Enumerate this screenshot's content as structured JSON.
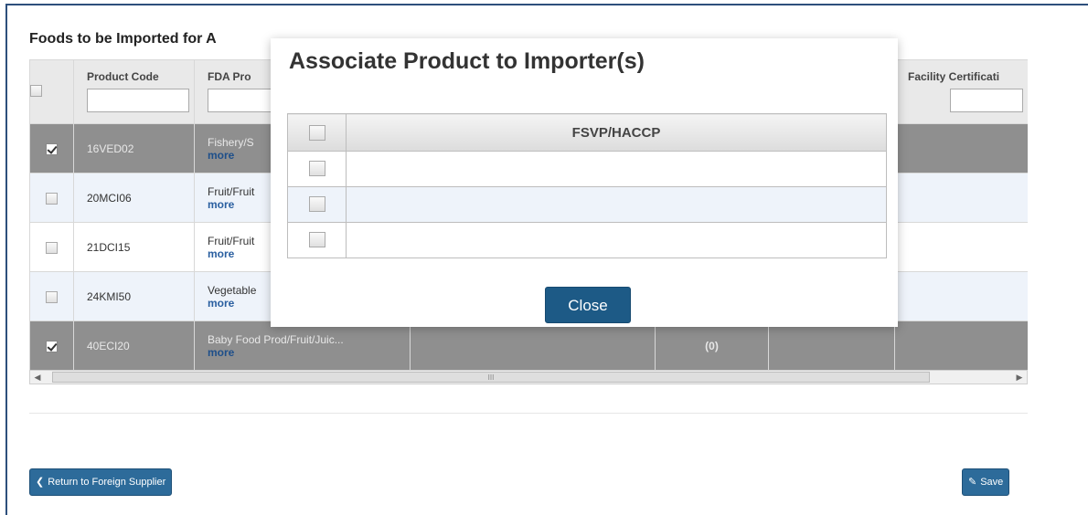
{
  "section": {
    "title": "Foods to be Imported for A"
  },
  "grid": {
    "columns": [
      {
        "label": "Product Code"
      },
      {
        "label": "FDA Pro"
      },
      {
        "label": ""
      },
      {
        "label": ""
      },
      {
        "label": ""
      },
      {
        "label": "Facility Certificati"
      }
    ],
    "rows": [
      {
        "code": "16VED02",
        "desc": "Fishery/S",
        "more": "more",
        "count": "",
        "selected": true
      },
      {
        "code": "20MCI06",
        "desc": "Fruit/Fruit",
        "more": "more",
        "count": "",
        "selected": false
      },
      {
        "code": "21DCI15",
        "desc": "Fruit/Fruit",
        "more": "more",
        "count": "",
        "selected": false
      },
      {
        "code": "24KMI50",
        "desc": "Vegetable",
        "more": "more",
        "count": "",
        "selected": false
      },
      {
        "code": "40ECI20",
        "desc": "Baby Food Prod/Fruit/Juic...",
        "more": "more",
        "count": "(0)",
        "selected": true
      }
    ],
    "scroll_thumb_glyph": "III"
  },
  "modal": {
    "title": "Associate Product to Importer(s)",
    "column_header": "FSVP/HACCP",
    "rows": [
      {
        "value": ""
      },
      {
        "value": ""
      },
      {
        "value": ""
      }
    ],
    "close_label": "Close"
  },
  "footer": {
    "return_label": "Return to Foreign Supplier",
    "save_label": "Save"
  },
  "colors": {
    "brand_button": "#2d6b9a",
    "selected_row": "#8f8f8f",
    "alt_row": "#eef3fa",
    "link": "#2a5fa0"
  }
}
